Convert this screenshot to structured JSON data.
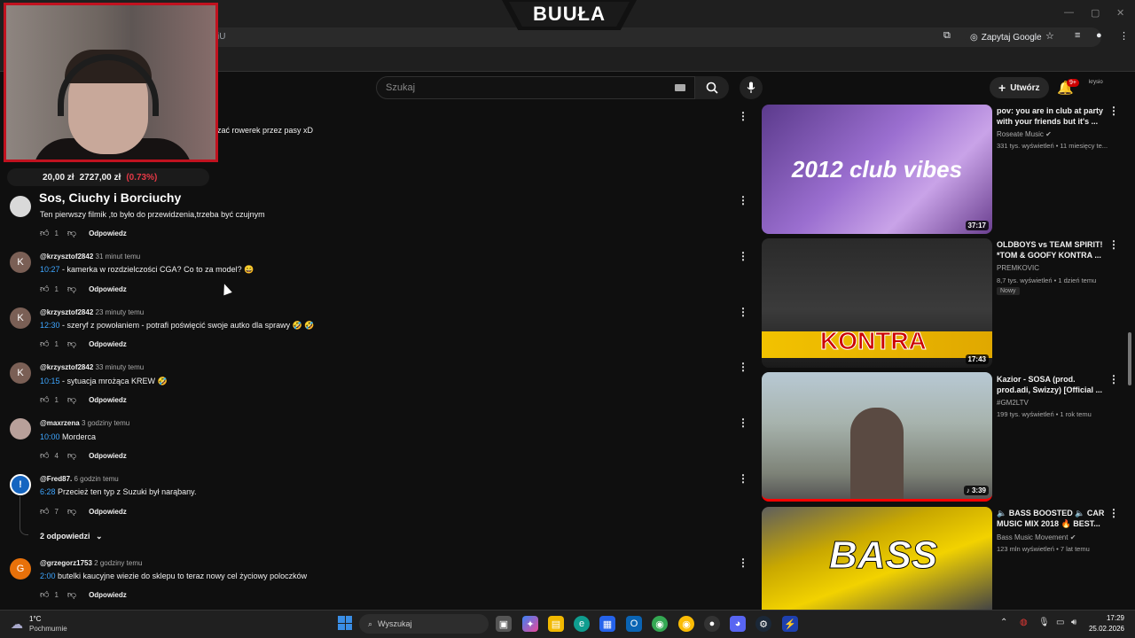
{
  "browser": {
    "url_fragment": "iU",
    "ask_google_label": "Zapytaj Google"
  },
  "overlay": {
    "banner_text": "BUUŁA",
    "ticker": {
      "left": "20,00 zł",
      "price": "2727,00 zł",
      "change": "(0.73%)"
    },
    "title": "Sos, Ciuchy i Borciuchy"
  },
  "masthead": {
    "search_placeholder": "Szukaj",
    "create_label": "Utwórz",
    "notification_count": "9+",
    "account_label": "krysio"
  },
  "comments": {
    "partial_top_text": "zać rowerek przez pasy xD",
    "items": [
      {
        "author": "",
        "time": "",
        "timestamp": "",
        "text": "Ten pierwszy filmik ,to było do przewidzenia,trzeba być czujnym",
        "likes": "1",
        "reply_label": "Odpowiedz",
        "avatar_letter": "",
        "avatar_color": "#d9d9d9"
      },
      {
        "author": "@krzysztof2842",
        "time": "31 minut temu",
        "timestamp": "10:27",
        "text": " - kamerka w rozdzielczości CGA? Co to za model? 😄",
        "likes": "1",
        "reply_label": "Odpowiedz",
        "avatar_letter": "K",
        "avatar_color": "#7a5f55"
      },
      {
        "author": "@krzysztof2842",
        "time": "23 minuty temu",
        "timestamp": "12:30",
        "text": " - szeryf z powołaniem - potrafi poświęcić swoje autko dla sprawy 🤣 🤣",
        "likes": "1",
        "reply_label": "Odpowiedz",
        "avatar_letter": "K",
        "avatar_color": "#7a5f55"
      },
      {
        "author": "@krzysztof2842",
        "time": "33 minuty temu",
        "timestamp": "10:15",
        "text": " - sytuacja mrożąca KREW 🤣",
        "likes": "1",
        "reply_label": "Odpowiedz",
        "avatar_letter": "K",
        "avatar_color": "#7a5f55"
      },
      {
        "author": "@maxrzena",
        "time": "3 godziny temu",
        "timestamp": "10:00",
        "text": " Morderca",
        "likes": "4",
        "reply_label": "Odpowiedz",
        "avatar_letter": "",
        "avatar_color": "#b8a09a"
      },
      {
        "author": "@Fred87.",
        "time": "6 godzin temu",
        "timestamp": "6:28",
        "text": " Przecież ten typ z Suzuki był narąbany.",
        "likes": "7",
        "reply_label": "Odpowiedz",
        "avatar_letter": "!",
        "avatar_color": "#1565c0"
      },
      {
        "author": "@grzegorz1753",
        "time": "2 godziny temu",
        "timestamp": "2:00",
        "text": "  butelki kaucyjne wiezie do sklepu to teraz nowy cel życiowy poloczków",
        "likes": "1",
        "reply_label": "Odpowiedz",
        "avatar_letter": "G",
        "avatar_color": "#e8710a"
      }
    ],
    "replies_toggle": "2 odpowiedzi"
  },
  "sidebar": {
    "videos": [
      {
        "title": "pov: you are in club at party with your friends but it's ...",
        "channel": "Roseate Music",
        "verified": true,
        "stats": "331 tys. wyświetleń • 11 miesięcy te...",
        "duration": "37:17",
        "thumb_text": "2012 club vibes",
        "badge": ""
      },
      {
        "title": "OLDBOYS vs TEAM SPIRIT! *TOM & GOOFY KONTRA ...",
        "channel": "PREMKOVIC",
        "verified": false,
        "stats": "8,7 tys. wyświetleń • 1 dzień temu",
        "duration": "17:43",
        "thumb_text": "KONTRA",
        "badge": "Nowy"
      },
      {
        "title": "Kazior - SOSA (prod. prod.adi, Swizzy) [Official ...",
        "channel": "#GM2LTV",
        "verified": false,
        "stats": "199 tys. wyświetleń • 1 rok temu",
        "duration": "3:39",
        "thumb_text": "",
        "badge": ""
      },
      {
        "title": "🔈 BASS BOOSTED 🔈 CAR MUSIC MIX 2018 🔥 BEST...",
        "channel": "Bass Music Movement",
        "verified": true,
        "stats": "123 mln wyświetleń • 7 lat temu",
        "duration": "",
        "thumb_text": "BASS",
        "badge": ""
      }
    ]
  },
  "taskbar": {
    "temp": "1°C",
    "weather": "Pochmurnie",
    "search_placeholder": "Wyszukaj",
    "time": "17:29",
    "date": "25.02.2026"
  },
  "colors": {
    "accent_red": "#c1121f",
    "link_blue": "#3ea6ff",
    "bg": "#0f0f0f"
  }
}
